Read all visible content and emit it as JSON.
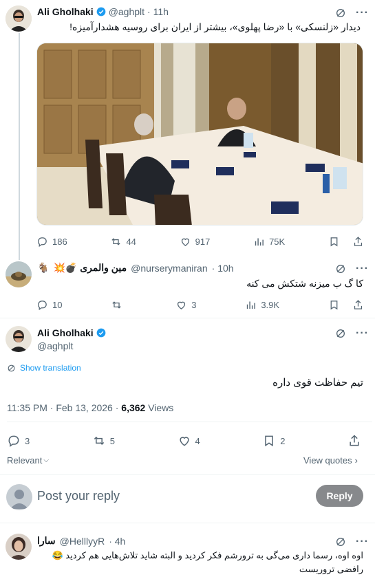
{
  "tweet1": {
    "name": "Ali Gholhaki",
    "handle": "@aghplt",
    "time": "· 11h",
    "text": "دیدار «زلنسکی» با «رضا پهلوی»، بیشتر از ایران برای روسیه هشدارآمیزه!",
    "stats": {
      "replies": "186",
      "retweets": "44",
      "likes": "917",
      "views": "75K"
    }
  },
  "reply1": {
    "name": "مین والمری 💣💥",
    "name_prefix_emoji": "🐐",
    "handle": "@nurserymaniran",
    "time": "· 10h",
    "text": "کا گ ب میزنه شتکش می کنه",
    "stats": {
      "replies": "10",
      "retweets": "",
      "likes": "3",
      "views": "3.9K"
    }
  },
  "main": {
    "name": "Ali Gholhaki",
    "handle": "@aghplt",
    "show_translation": "Show translation",
    "text": "تیم حفاظت قوی داره",
    "timestamp": "11:35 PM · Feb 13, 2026 · ",
    "views_count": "6,362",
    "views_label": " Views",
    "stats": {
      "replies": "3",
      "retweets": "5",
      "likes": "4",
      "bookmarks": "2"
    },
    "relevant": "Relevant",
    "view_quotes": "View quotes"
  },
  "compose": {
    "placeholder": "Post your reply",
    "button": "Reply"
  },
  "reply2": {
    "name": "سارا",
    "handle": "@HelllyyR",
    "time": "· 4h",
    "line1": "اوه اوه، رسما داری می‌گی به ترورشم فکر کردید و البته شاید تلاش‌هایی هم کردید 😂",
    "line2": "رافضی تروریست"
  },
  "colors": {
    "accent": "#1d9bf0",
    "muted": "#536471",
    "reply_button": "#87898c"
  }
}
